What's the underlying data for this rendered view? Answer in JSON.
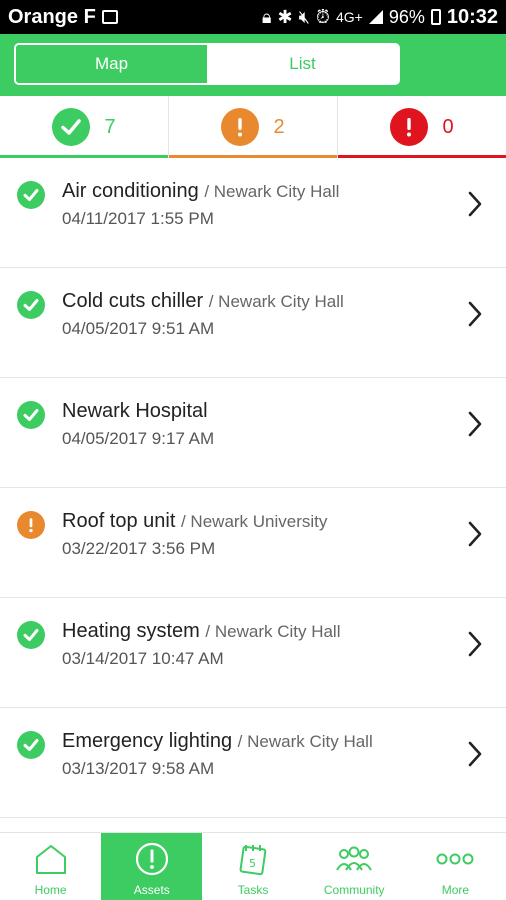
{
  "status_bar": {
    "carrier": "Orange F",
    "network": "4G+",
    "battery": "96%",
    "time": "10:32"
  },
  "tabs": {
    "map_label": "Map",
    "list_label": "List",
    "selected": "Map"
  },
  "summary": {
    "ok_count": "7",
    "warn_count": "2",
    "error_count": "0"
  },
  "assets": [
    {
      "status": "ok",
      "name": "Air conditioning",
      "location": "/ Newark City Hall",
      "date": "04/11/2017 1:55 PM"
    },
    {
      "status": "ok",
      "name": "Cold cuts chiller",
      "location": "/ Newark City Hall",
      "date": "04/05/2017 9:51 AM"
    },
    {
      "status": "ok",
      "name": "Newark Hospital",
      "location": "",
      "date": "04/05/2017 9:17 AM"
    },
    {
      "status": "warn",
      "name": "Roof top unit",
      "location": "/ Newark University",
      "date": "03/22/2017 3:56 PM"
    },
    {
      "status": "ok",
      "name": "Heating system",
      "location": "/ Newark City Hall",
      "date": "03/14/2017 10:47 AM"
    },
    {
      "status": "ok",
      "name": "Emergency lighting",
      "location": "/ Newark City Hall",
      "date": "03/13/2017 9:58 AM"
    }
  ],
  "bottom_nav": {
    "home": "Home",
    "assets": "Assets",
    "tasks": "Tasks",
    "community": "Community",
    "more": "More",
    "active": "Assets"
  },
  "colors": {
    "brand_green": "#3dcc61",
    "warning_orange": "#e8892f",
    "error_red": "#e0141e"
  }
}
